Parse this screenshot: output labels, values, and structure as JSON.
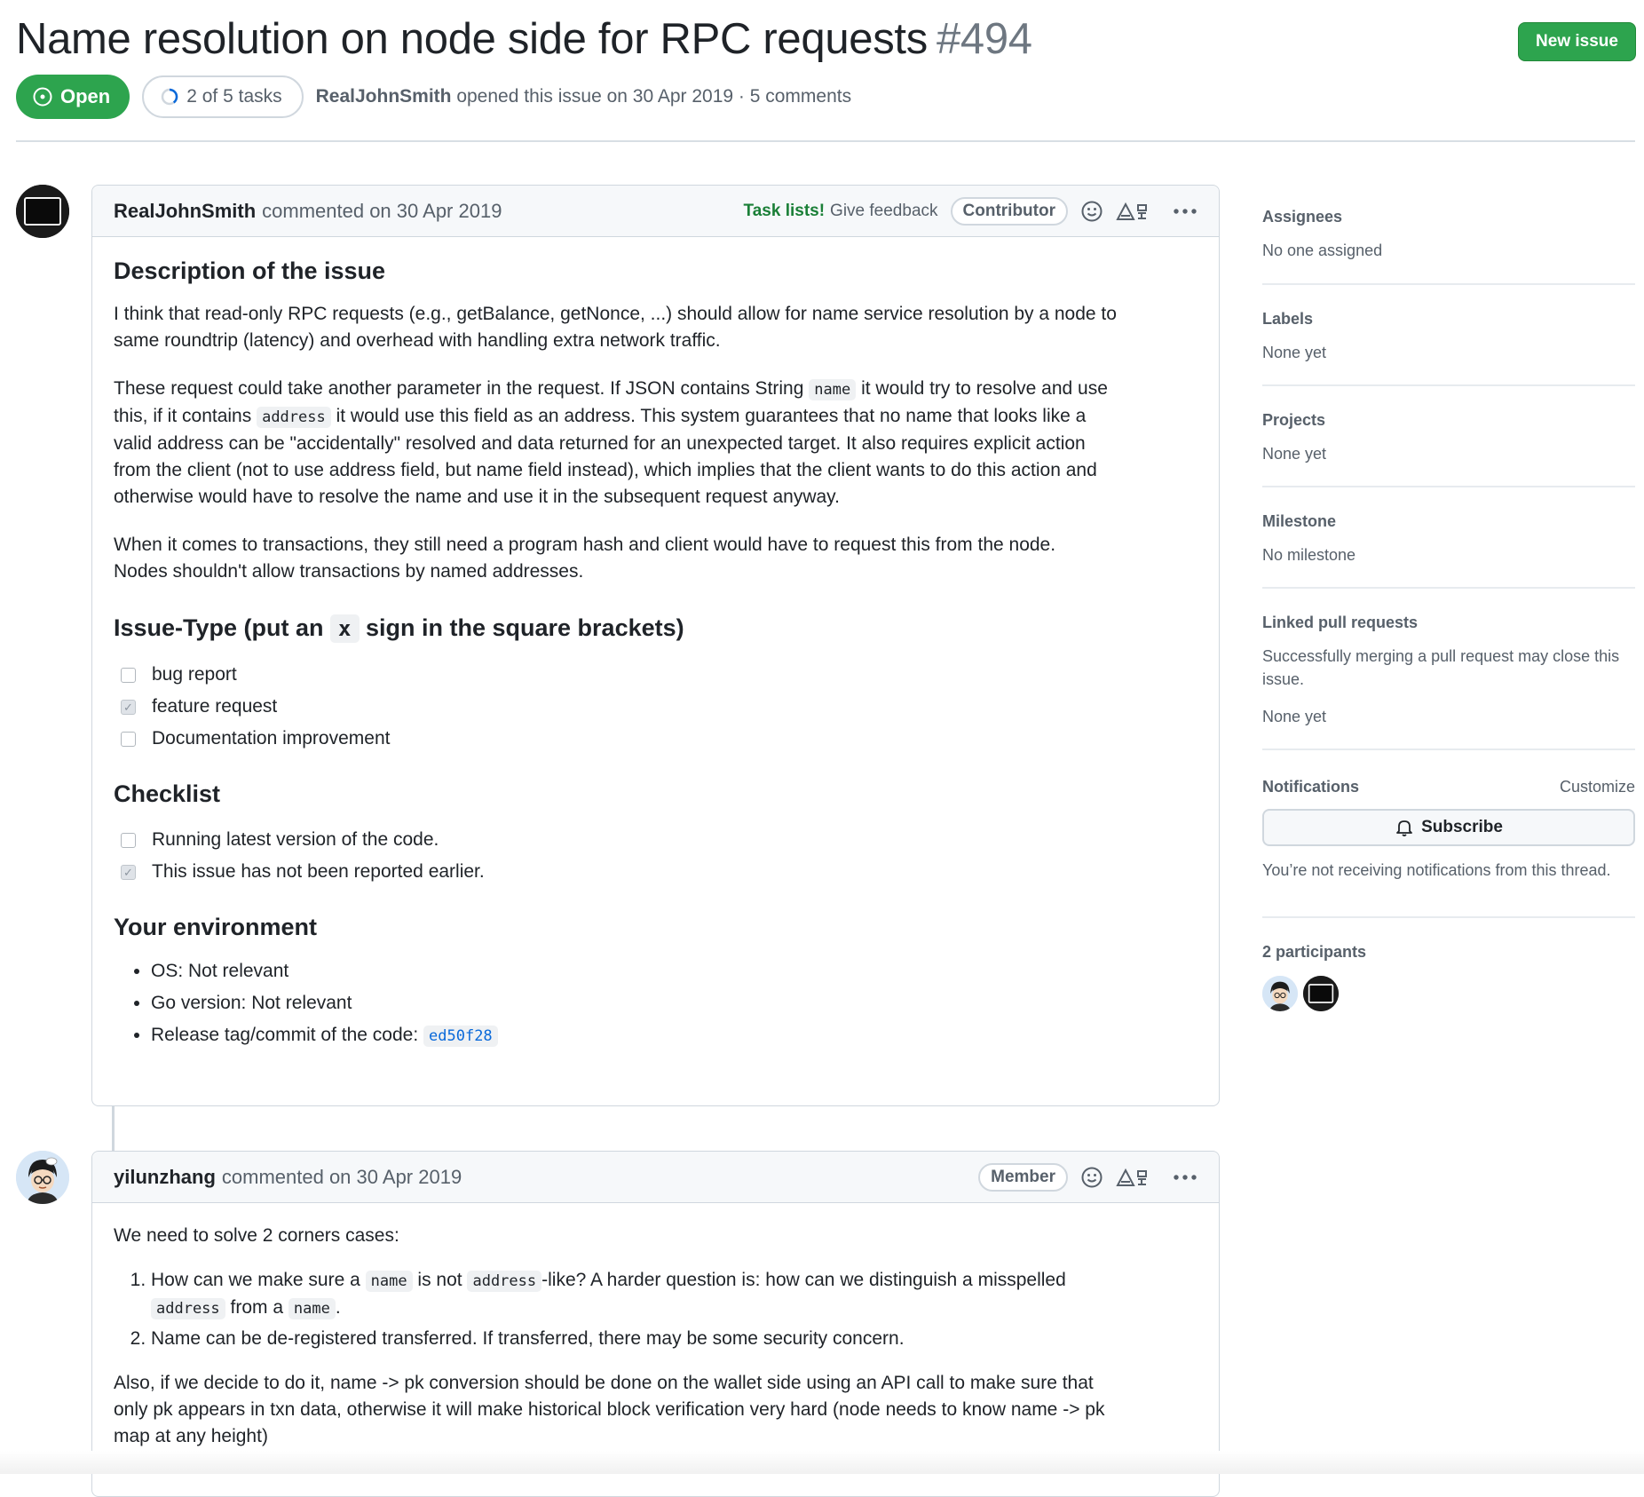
{
  "issue": {
    "title": "Name resolution on node side for RPC requests",
    "number": "#494",
    "state": "Open",
    "tasks": "2 of 5 tasks",
    "author": "RealJohnSmith",
    "opened_text": "opened this issue on 30 Apr 2019 · 5 comments",
    "new_issue_label": "New issue"
  },
  "comments": [
    {
      "author": "RealJohnSmith",
      "action": "commented on 30 Apr 2019",
      "tasklist_label": "Task lists!",
      "feedback_label": "Give feedback",
      "role": "Contributor",
      "h_description": "Description of the issue",
      "p1": "I think that read-only RPC requests (e.g., getBalance, getNonce, ...) should allow for name service resolution by a node to",
      "p1b": "same roundtrip (latency) and overhead with handling extra network traffic.",
      "p2_a": "These request could take another parameter in the request. If JSON contains String",
      "p2_code1": "name",
      "p2_b": "it would try to resolve and use",
      "p2_c": "this, if it contains",
      "p2_code2": "address",
      "p2_d": "it would use this field as an address. This system guarantees that no name that looks like a",
      "p2_e": "valid address can be \"accidentally\" resolved and data returned for an unexpected target. It also requires explicit action",
      "p2_f": "from the client (not to use address field, but name field instead), which implies that the client wants to do this action and",
      "p2_g": "otherwise would have to resolve the name and use it in the subsequent request anyway.",
      "p3a": "When it comes to transactions, they still need a program hash and client would have to request this from the node.",
      "p3b": "Nodes shouldn't allow transactions by named addresses.",
      "h_issue_type_a": "Issue-Type (put an",
      "h_issue_type_code": "x",
      "h_issue_type_b": "sign in the square brackets)",
      "issue_types": [
        {
          "label": "bug report",
          "checked": false
        },
        {
          "label": "feature request",
          "checked": true
        },
        {
          "label": "Documentation improvement",
          "checked": false
        }
      ],
      "h_checklist": "Checklist",
      "checklist": [
        {
          "label": "Running latest version of the code.",
          "checked": false
        },
        {
          "label": "This issue has not been reported earlier.",
          "checked": true
        }
      ],
      "h_env": "Your environment",
      "env_os": "OS: Not relevant",
      "env_go": "Go version: Not relevant",
      "env_release": "Release tag/commit of the code:",
      "env_commit": "ed50f28"
    },
    {
      "author": "yilunzhang",
      "action": "commented on 30 Apr 2019",
      "role": "Member",
      "intro": "We need to solve 2 corners cases:",
      "li1_a": "How can we make sure a",
      "li1_code1": "name",
      "li1_b": "is not",
      "li1_code2": "address",
      "li1_c": "-like? A harder question is: how can we distinguish a misspelled",
      "li1_code3": "address",
      "li1_d": "from a",
      "li1_code4": "name",
      "li1_e": ".",
      "li2": "Name can be de-registered transferred. If transferred, there may be some security concern.",
      "p_a": "Also, if we decide to do it, name -> pk conversion should be done on the wallet side using an API call to make sure that",
      "p_b": "only pk appears in txn data, otherwise it will make historical block verification very hard (node needs to know name -> pk",
      "p_c": "map at any height)"
    }
  ],
  "sidebar": {
    "assignees_title": "Assignees",
    "assignees_value": "No one assigned",
    "labels_title": "Labels",
    "labels_value": "None yet",
    "projects_title": "Projects",
    "projects_value": "None yet",
    "milestone_title": "Milestone",
    "milestone_value": "No milestone",
    "linked_title": "Linked pull requests",
    "linked_desc": "Successfully merging a pull request may close this issue.",
    "linked_value": "None yet",
    "notifications_title": "Notifications",
    "customize_label": "Customize",
    "subscribe_label": "Subscribe",
    "notifications_desc": "You’re not receiving notifications from this thread.",
    "participants_title": "2 participants"
  },
  "colors": {
    "open_green": "#2da44e",
    "link_blue": "#0969da",
    "text_muted": "#57606a",
    "border": "#d0d7de"
  },
  "icons": [
    "issue-opened-icon",
    "progress-ring-icon",
    "smiley-icon",
    "translate-icon",
    "kebab-horizontal-icon",
    "bell-icon"
  ]
}
